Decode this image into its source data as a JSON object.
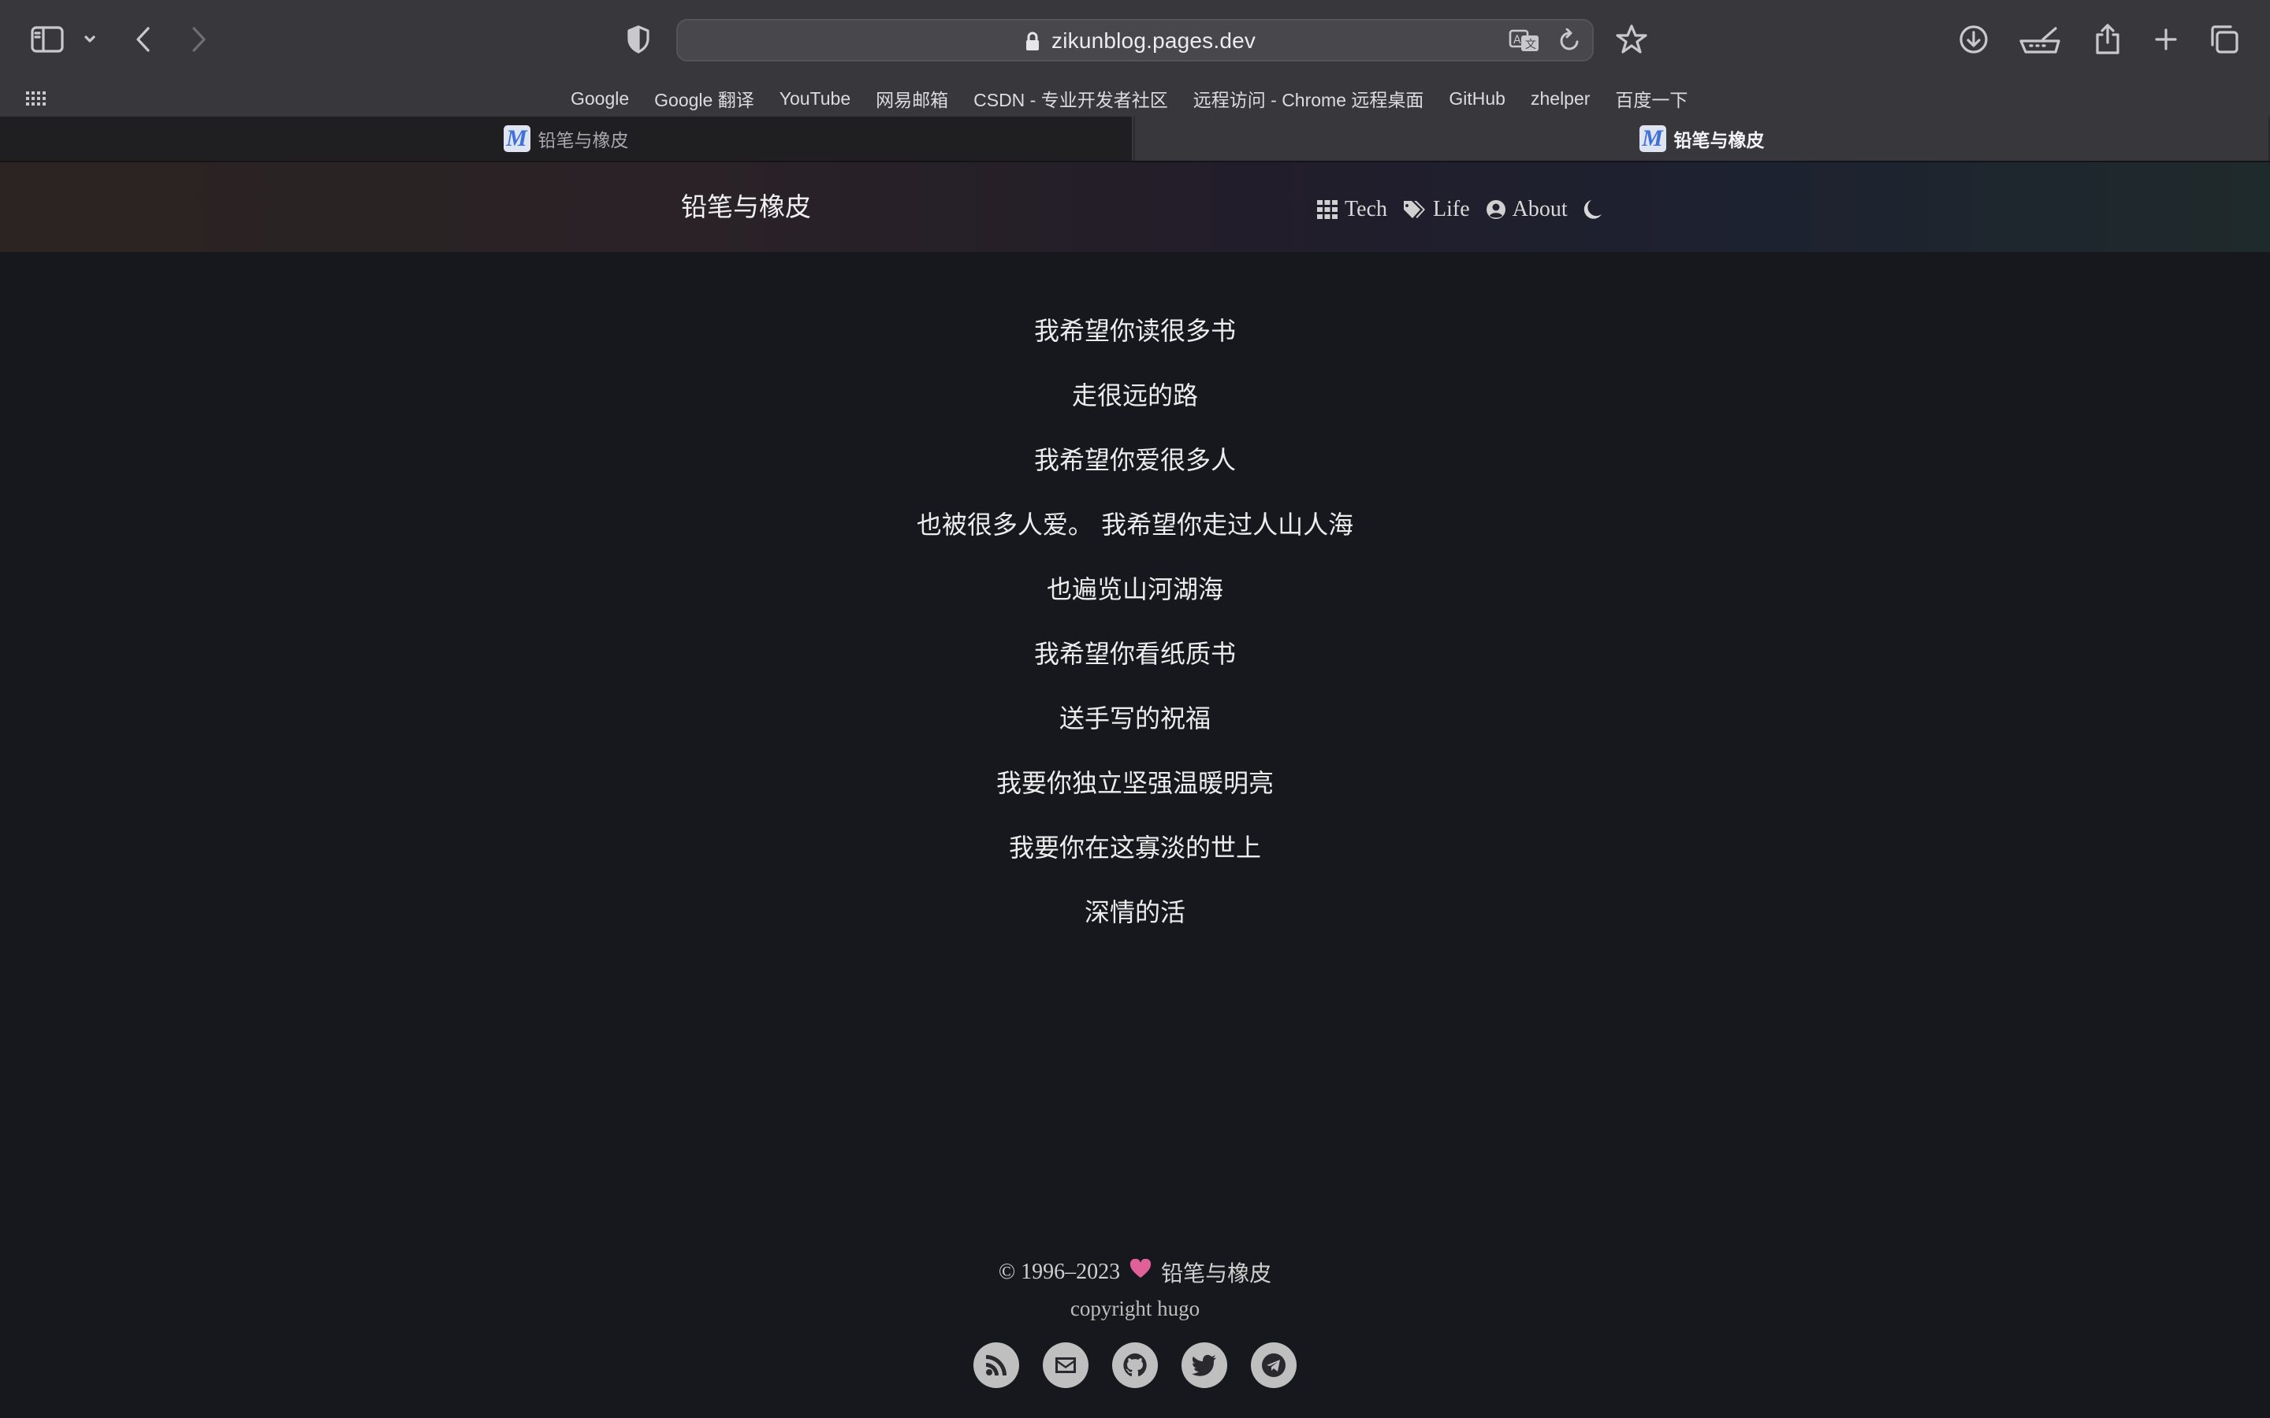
{
  "browser": {
    "url": "zikunblog.pages.dev",
    "bookmarks": [
      "Google",
      "Google 翻译",
      "YouTube",
      "网易邮箱",
      "CSDN - 专业开发者社区",
      "远程访问 - Chrome 远程桌面",
      "GitHub",
      "zhelper",
      "百度一下"
    ],
    "tabs": [
      {
        "title": "铅笔与橡皮",
        "active": false
      },
      {
        "title": "铅笔与橡皮",
        "active": true
      }
    ]
  },
  "site": {
    "title": "铅笔与橡皮",
    "nav": [
      {
        "label": "Tech",
        "icon": "grid-icon"
      },
      {
        "label": "Life",
        "icon": "tags-icon"
      },
      {
        "label": "About",
        "icon": "user-circle-icon"
      }
    ],
    "theme_toggle_icon": "moon-icon"
  },
  "poem": [
    "我希望你读很多书",
    "走很远的路",
    "我希望你爱很多人",
    "也被很多人爱。 我希望你走过人山人海",
    "也遍览山河湖海",
    "我希望你看纸质书",
    "送手写的祝福",
    "我要你独立坚强温暖明亮",
    "我要你在这寡淡的世上",
    "深情的活"
  ],
  "footer": {
    "copyright": "© 1996–2023",
    "site_name": "铅笔与橡皮",
    "powered": "copyright hugo",
    "socials": [
      "rss-icon",
      "email-icon",
      "github-icon",
      "twitter-icon",
      "telegram-icon"
    ],
    "heart_color": "#e0609a"
  }
}
